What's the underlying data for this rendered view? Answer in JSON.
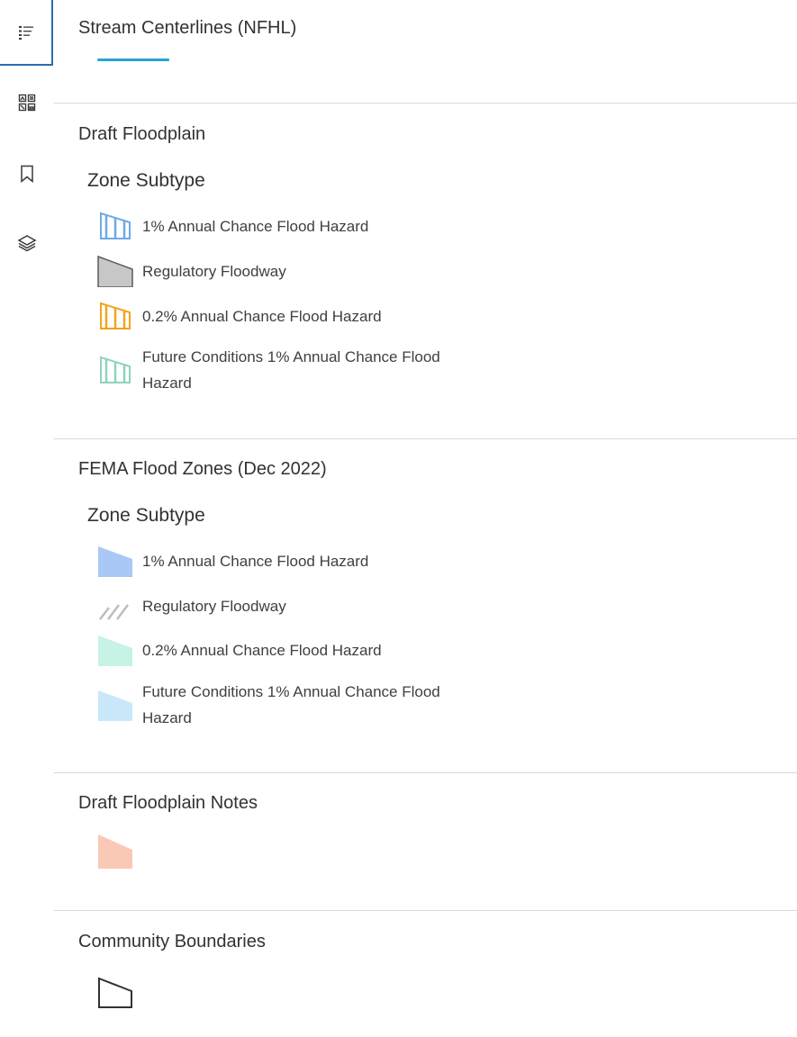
{
  "toolbar": {
    "items": [
      {
        "name": "legend",
        "active": true
      },
      {
        "name": "basemap-gallery",
        "active": false
      },
      {
        "name": "bookmarks",
        "active": false
      },
      {
        "name": "layers",
        "active": false
      }
    ]
  },
  "legend": {
    "stream": {
      "title": "Stream Centerlines (NFHL)",
      "line_color": "#27a5d6"
    },
    "draft": {
      "title": "Draft Floodplain",
      "subtype": "Zone Subtype",
      "items": [
        {
          "label": "1% Annual Chance Flood Hazard",
          "color": "#6fa8e6"
        },
        {
          "label": "Regulatory Floodway",
          "color": "#c7c7c7"
        },
        {
          "label": "0.2% Annual Chance Flood Hazard",
          "color": "#f1a51c"
        },
        {
          "label": "Future Conditions 1% Annual Chance Flood Hazard",
          "color": "#8fd4bd"
        }
      ]
    },
    "fema": {
      "title": "FEMA Flood Zones (Dec 2022)",
      "subtype": "Zone Subtype",
      "items": [
        {
          "label": "1% Annual Chance Flood Hazard",
          "color": "#a9c8f5"
        },
        {
          "label": "Regulatory Floodway",
          "color": "#bdbdbd"
        },
        {
          "label": "0.2% Annual Chance Flood Hazard",
          "color": "#c6f3e6"
        },
        {
          "label": "Future Conditions 1% Annual Chance Flood Hazard",
          "color": "#c9e9fb"
        }
      ]
    },
    "notes": {
      "title": "Draft Floodplain Notes",
      "color": "#f9c9b5"
    },
    "community": {
      "title": "Community Boundaries",
      "color": "#323232"
    }
  }
}
